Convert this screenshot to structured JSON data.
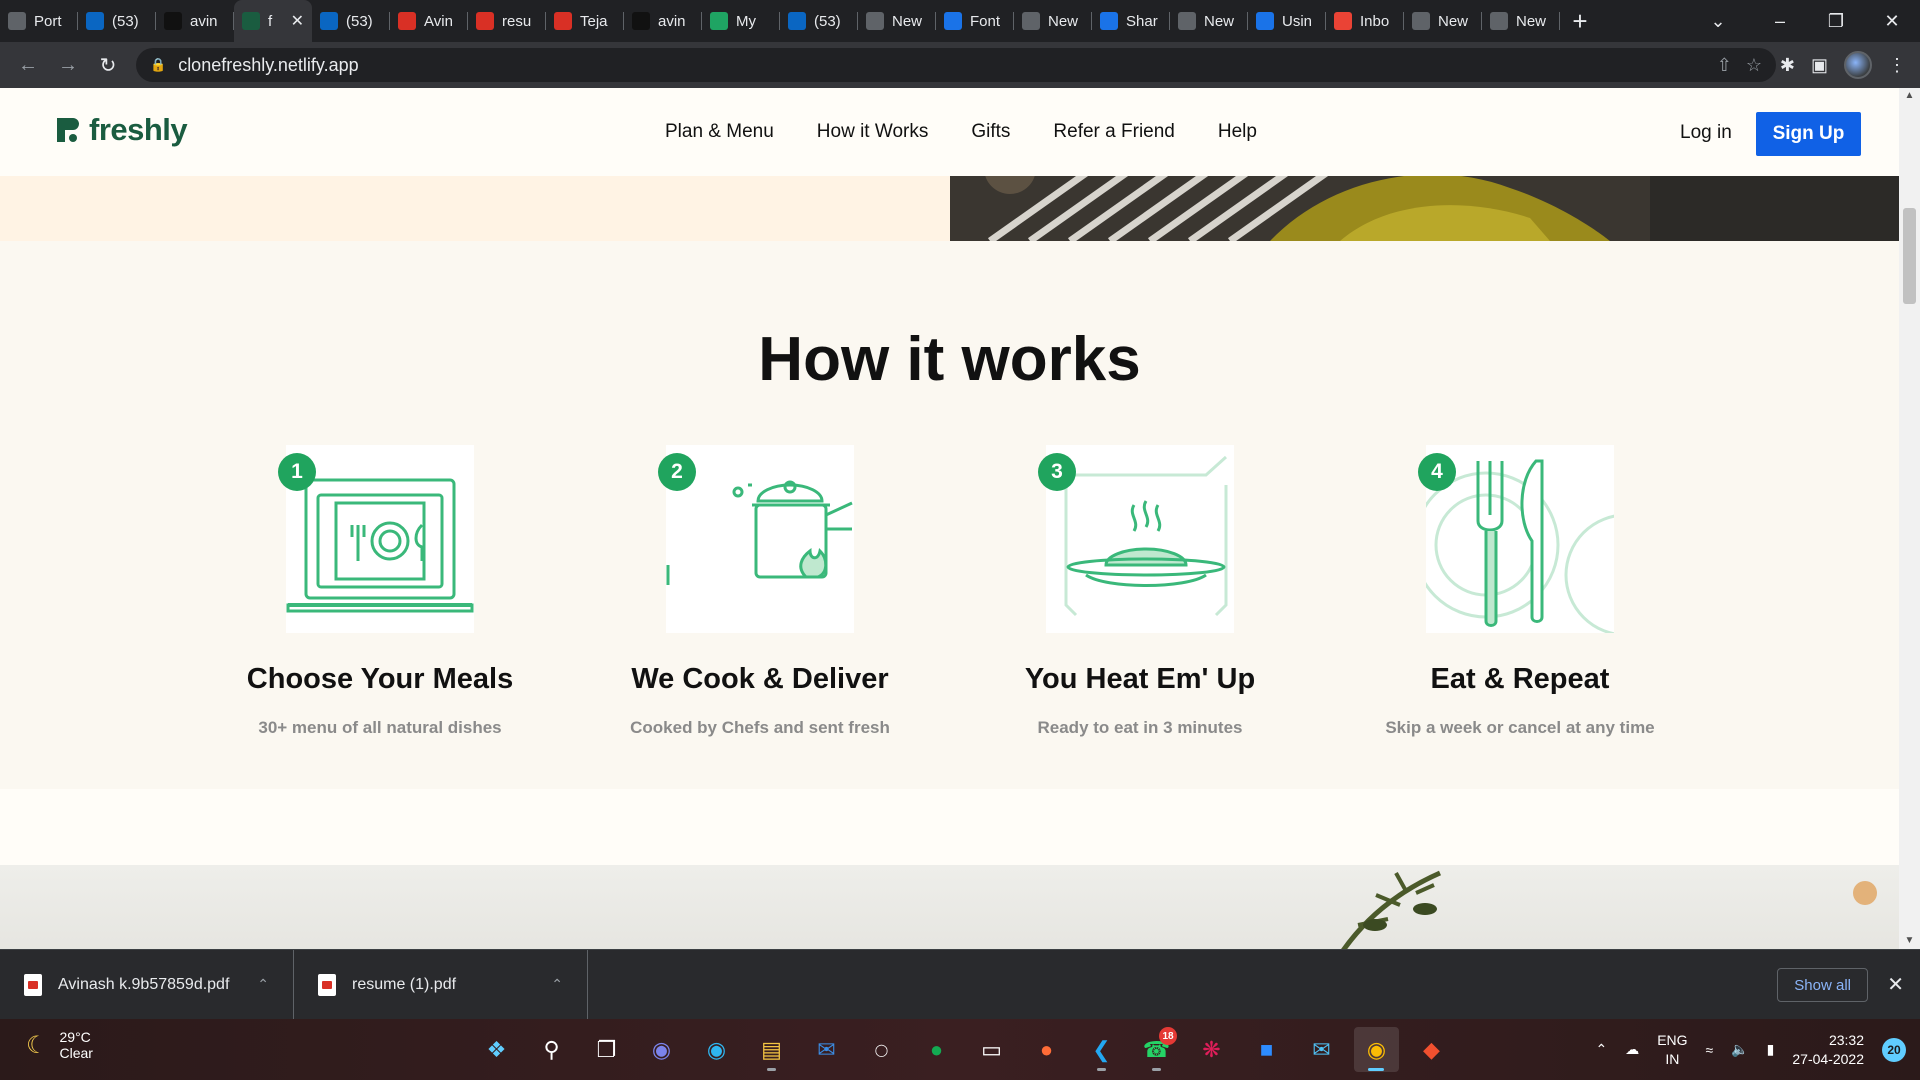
{
  "browser": {
    "tabs": [
      {
        "label": "Port",
        "icon": "portfolio-icon",
        "color": "#5f6368"
      },
      {
        "label": "(53)",
        "icon": "linkedin-icon",
        "color": "#0a66c2"
      },
      {
        "label": "avin",
        "icon": "github-icon",
        "color": "#111111"
      },
      {
        "label": "f",
        "icon": "freshly-icon",
        "color": "#1a5c40",
        "active": true
      },
      {
        "label": "(53)",
        "icon": "linkedin-icon",
        "color": "#0a66c2"
      },
      {
        "label": "Avin",
        "icon": "pdf-icon",
        "color": "#d93025"
      },
      {
        "label": "resu",
        "icon": "pdf-icon",
        "color": "#d93025"
      },
      {
        "label": "Teja",
        "icon": "pdf-icon",
        "color": "#d93025"
      },
      {
        "label": "avin",
        "icon": "github-icon",
        "color": "#111111"
      },
      {
        "label": "My",
        "icon": "drive-icon",
        "color": "#1fa463"
      },
      {
        "label": "(53)",
        "icon": "linkedin-icon",
        "color": "#0a66c2"
      },
      {
        "label": "New",
        "icon": "chrome-icon",
        "color": "#5f6368"
      },
      {
        "label": "Font",
        "icon": "flag-icon",
        "color": "#1a73e8"
      },
      {
        "label": "New",
        "icon": "chrome-icon",
        "color": "#5f6368"
      },
      {
        "label": "Shar",
        "icon": "s-icon",
        "color": "#1a73e8"
      },
      {
        "label": "New",
        "icon": "chrome-icon",
        "color": "#5f6368"
      },
      {
        "label": "Usin",
        "icon": "loop-icon",
        "color": "#1a73e8"
      },
      {
        "label": "Inbo",
        "icon": "gmail-icon",
        "color": "#ea4335"
      },
      {
        "label": "New",
        "icon": "chrome-icon",
        "color": "#5f6368"
      },
      {
        "label": "New",
        "icon": "chrome-icon",
        "color": "#5f6368"
      }
    ],
    "new_tab": "+",
    "url": "clonefreshly.netlify.app"
  },
  "site": {
    "logo": "freshly",
    "nav": [
      "Plan & Menu",
      "How it Works",
      "Gifts",
      "Refer a Friend",
      "Help"
    ],
    "login": "Log in",
    "signup": "Sign Up",
    "section_title": "How it works",
    "steps": [
      {
        "n": "1",
        "title": "Choose Your Meals",
        "desc": "30+ menu of all natural dishes"
      },
      {
        "n": "2",
        "title": "We Cook & Deliver",
        "desc": "Cooked by Chefs and sent fresh"
      },
      {
        "n": "3",
        "title": "You Heat Em' Up",
        "desc": "Ready to eat in 3 minutes"
      },
      {
        "n": "4",
        "title": "Eat & Repeat",
        "desc": "Skip a week or cancel at any time"
      }
    ],
    "accent": "#20a45e",
    "signup_color": "#1061e6"
  },
  "downloads": {
    "items": [
      "Avinash k.9b57859d.pdf",
      "resume (1).pdf"
    ],
    "show_all": "Show all"
  },
  "taskbar": {
    "temp": "29°C",
    "condition": "Clear",
    "lang1": "ENG",
    "lang2": "IN",
    "time": "23:32",
    "date": "27-04-2022",
    "notification_count": "20",
    "whatsapp_badge": "18"
  }
}
